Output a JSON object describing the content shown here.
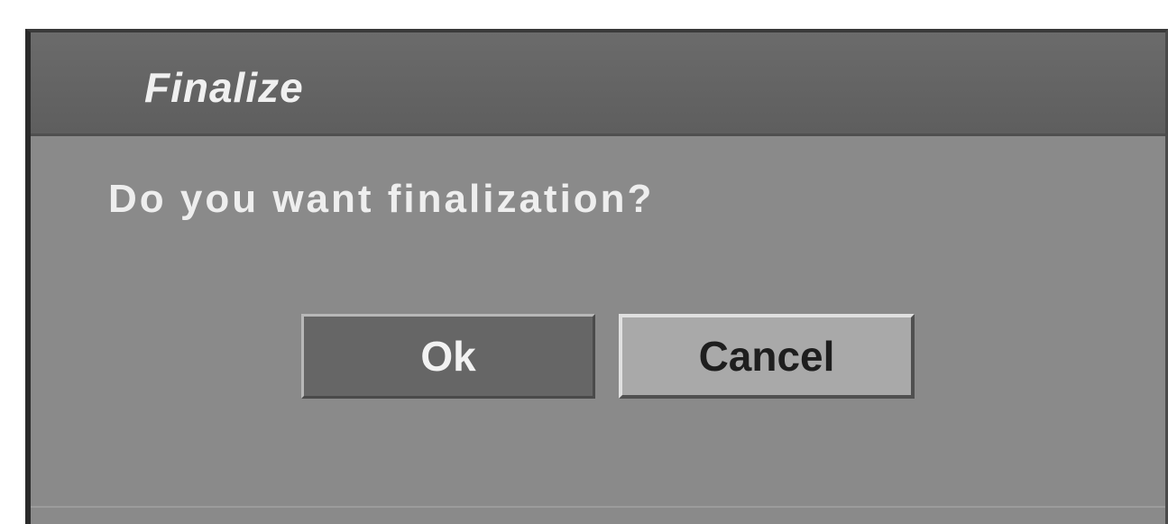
{
  "dialog": {
    "title": "Finalize",
    "message": "Do you want finalization?",
    "buttons": {
      "ok_label": "Ok",
      "cancel_label": "Cancel"
    },
    "selected_button": "Cancel"
  },
  "colors": {
    "dialog_background": "#8a8a8a",
    "title_bar": "#646464",
    "ok_button": "#666666",
    "cancel_button_selected": "#a9a9a9",
    "text_light": "#eeeeee",
    "text_dark": "#1e1e1e"
  }
}
